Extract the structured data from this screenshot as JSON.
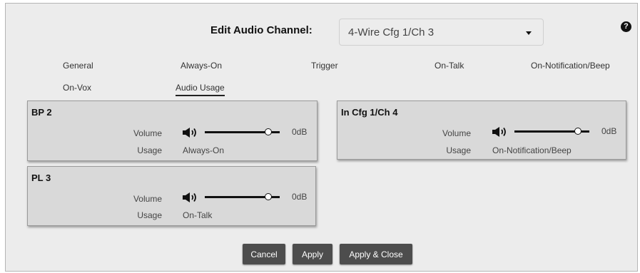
{
  "header": {
    "title": "Edit Audio Channel:",
    "channel_select": {
      "value": "4-Wire Cfg 1/Ch 3",
      "icon": "chevron-down-icon"
    },
    "help_icon": "?"
  },
  "tabs": [
    {
      "label": "General",
      "active": false
    },
    {
      "label": "Always-On",
      "active": false
    },
    {
      "label": "Trigger",
      "active": false
    },
    {
      "label": "On-Talk",
      "active": false
    },
    {
      "label": "On-Notification/Beep",
      "active": false
    },
    {
      "label": "On-Vox",
      "active": false
    },
    {
      "label": "Audio Usage",
      "active": true
    }
  ],
  "usage_cards": [
    {
      "title": "BP 2",
      "volume_label": "Volume",
      "volume_value": "0dB",
      "volume_level": 0.85,
      "usage_label": "Usage",
      "usage_value": "Always-On"
    },
    {
      "title": "In Cfg 1/Ch 4",
      "volume_label": "Volume",
      "volume_value": "0dB",
      "volume_level": 0.85,
      "usage_label": "Usage",
      "usage_value": "On-Notification/Beep"
    },
    {
      "title": "PL 3",
      "volume_label": "Volume",
      "volume_value": "0dB",
      "volume_level": 0.85,
      "usage_label": "Usage",
      "usage_value": "On-Talk"
    }
  ],
  "buttons": {
    "cancel": "Cancel",
    "apply": "Apply",
    "apply_close": "Apply & Close"
  },
  "colors": {
    "dialog_bg": "#ececec",
    "card_bg": "#d9d9d9",
    "button_bg": "#4d4d4d"
  }
}
